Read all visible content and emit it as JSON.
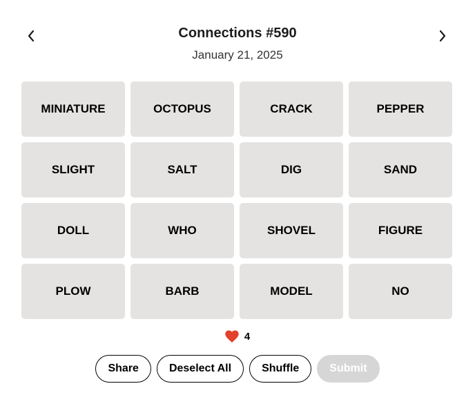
{
  "header": {
    "title": "Connections #590",
    "date": "January 21, 2025",
    "prev_icon": "chevron-left-icon",
    "next_icon": "chevron-right-icon"
  },
  "tiles": [
    "MINIATURE",
    "OCTOPUS",
    "CRACK",
    "PEPPER",
    "SLIGHT",
    "SALT",
    "DIG",
    "SAND",
    "DOLL",
    "WHO",
    "SHOVEL",
    "FIGURE",
    "PLOW",
    "BARB",
    "MODEL",
    "NO"
  ],
  "lives": {
    "icon": "heart-icon",
    "color": "#e2412c",
    "count": "4"
  },
  "buttons": {
    "share": "Share",
    "deselect_all": "Deselect All",
    "shuffle": "Shuffle",
    "submit": "Submit"
  },
  "colors": {
    "tile_bg": "#e5e3e1",
    "submit_disabled_bg": "#d6d6d6"
  }
}
